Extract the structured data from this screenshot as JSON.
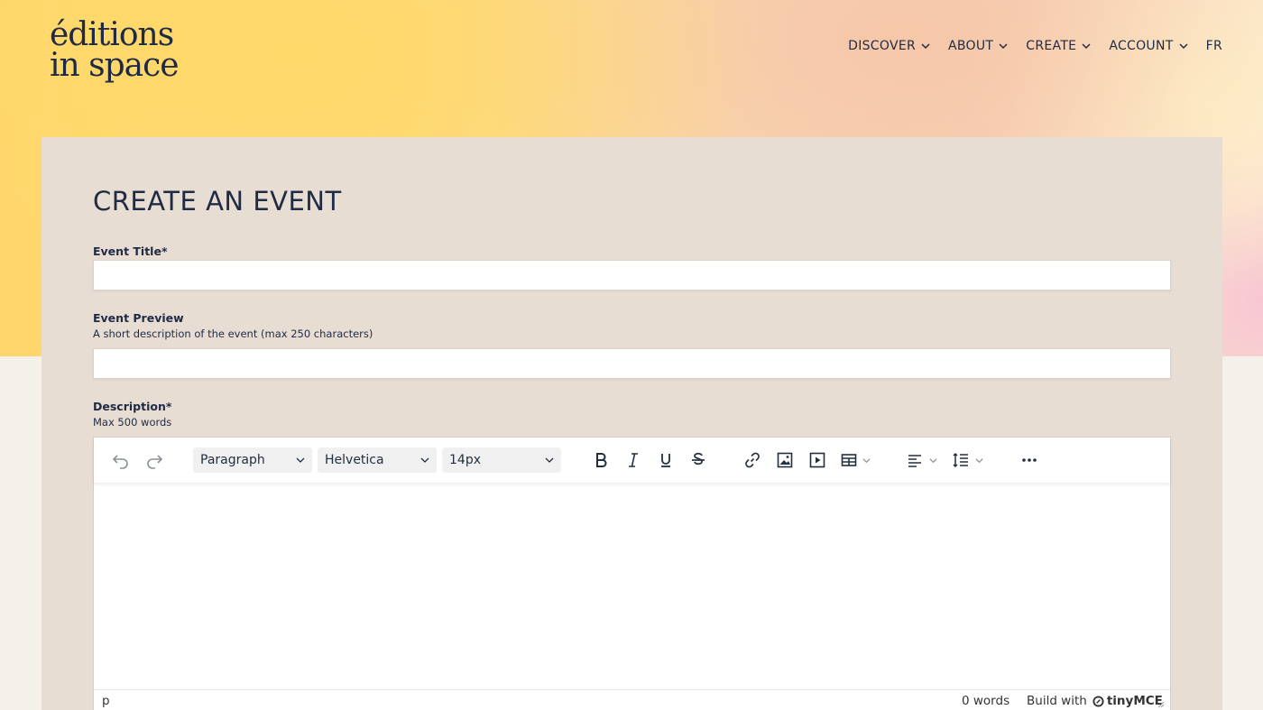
{
  "brand": {
    "logo_line1": "éditions",
    "logo_line2": "in space"
  },
  "nav": {
    "items": [
      {
        "label": "DISCOVER",
        "has_dropdown": true
      },
      {
        "label": "ABOUT",
        "has_dropdown": true
      },
      {
        "label": "CREATE",
        "has_dropdown": true
      },
      {
        "label": "ACCOUNT",
        "has_dropdown": true
      }
    ],
    "lang": "FR"
  },
  "form": {
    "title": "CREATE AN EVENT",
    "event_title": {
      "label": "Event Title*",
      "value": ""
    },
    "event_preview": {
      "label": "Event Preview",
      "hint": "A short description of the event (max 250 characters)",
      "value": ""
    },
    "description": {
      "label": "Description*",
      "hint": "Max 500 words"
    }
  },
  "editor": {
    "block_format": "Paragraph",
    "font_family": "Helvetica",
    "font_size": "14px",
    "status_path": "p",
    "word_count": "0 words",
    "build_with": "Build with",
    "tiny_brand": "tinyMCE"
  },
  "colors": {
    "text": "#1f2a44",
    "panel": "#e8ddd3",
    "page_bottom": "#f4f0ea"
  }
}
